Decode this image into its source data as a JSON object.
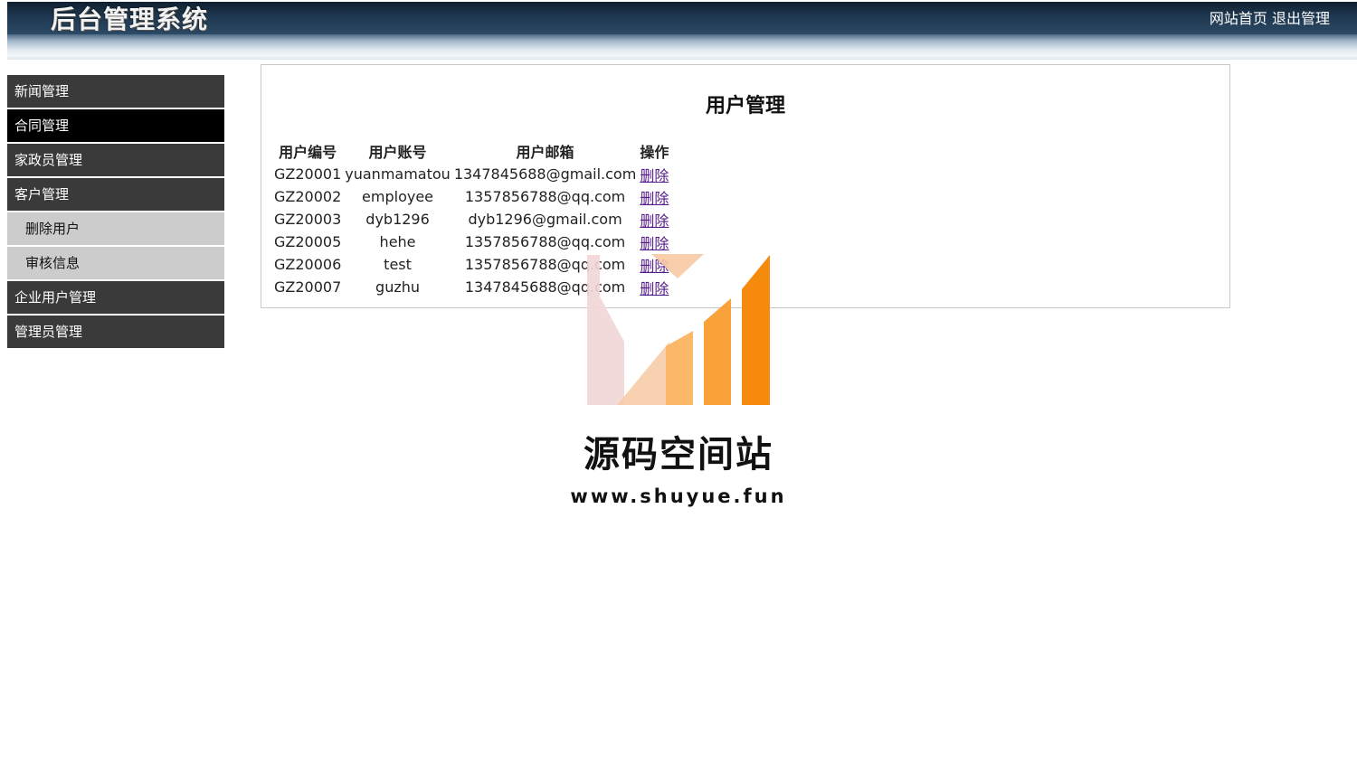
{
  "header": {
    "title": "后台管理系统",
    "links": {
      "home": "网站首页",
      "logout": "退出管理"
    }
  },
  "sidebar": {
    "items": [
      {
        "label": "新闻管理"
      },
      {
        "label": "合同管理",
        "active": true
      },
      {
        "label": "家政员管理"
      },
      {
        "label": "客户管理"
      },
      {
        "label": "删除用户",
        "sub": true
      },
      {
        "label": "审核信息",
        "sub": true
      },
      {
        "label": "企业用户管理"
      },
      {
        "label": "管理员管理"
      }
    ]
  },
  "main": {
    "title": "用户管理",
    "table": {
      "headers": [
        "用户编号",
        "用户账号",
        "用户邮箱",
        "操作"
      ],
      "rows": [
        {
          "id": "GZ20001",
          "account": "yuanmamatou",
          "email": "1347845688@gmail.com",
          "action": "删除"
        },
        {
          "id": "GZ20002",
          "account": "employee",
          "email": "1357856788@qq.com",
          "action": "删除"
        },
        {
          "id": "GZ20003",
          "account": "dyb1296",
          "email": "dyb1296@gmail.com",
          "action": "删除"
        },
        {
          "id": "GZ20005",
          "account": "hehe",
          "email": "1357856788@qq.com",
          "action": "删除"
        },
        {
          "id": "GZ20006",
          "account": "test",
          "email": "1357856788@qq.com",
          "action": "删除"
        },
        {
          "id": "GZ20007",
          "account": "guzhu",
          "email": "1347845688@qq.com",
          "action": "删除"
        }
      ]
    }
  },
  "watermark": {
    "name": "源码空间站",
    "url": "www.shuyue.fun",
    "colors": [
      "#f2d6d6",
      "#f7c9a3",
      "#fbb869",
      "#f9a23a",
      "#f68a0c"
    ]
  }
}
